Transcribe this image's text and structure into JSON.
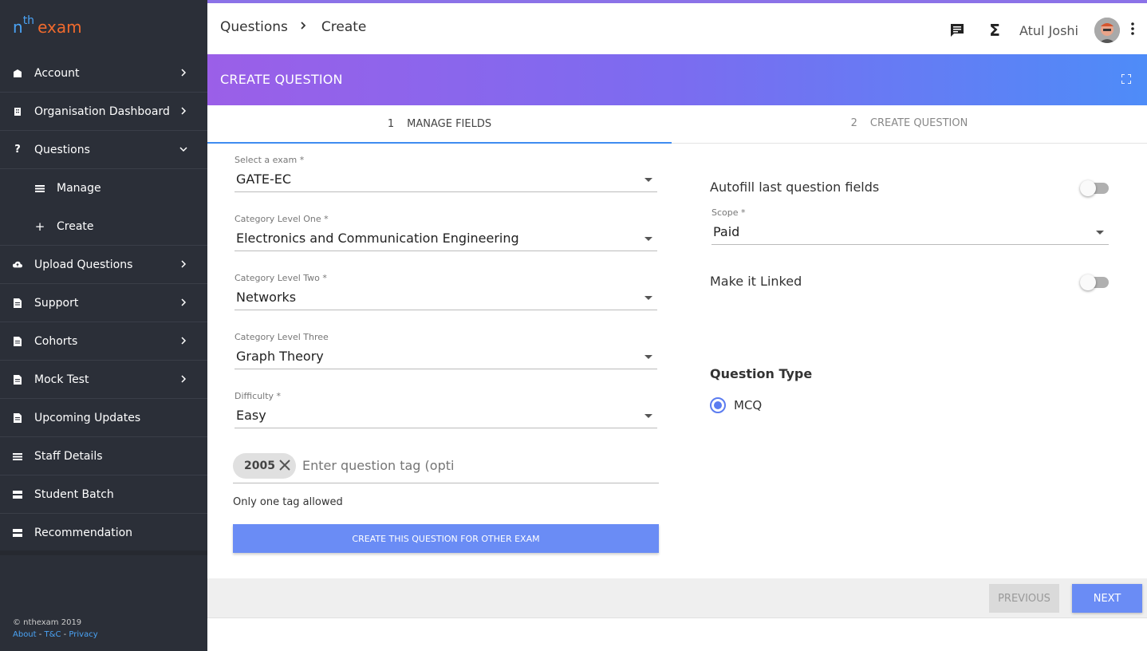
{
  "logo": {
    "n": "n",
    "th": "th",
    "exam": "exam"
  },
  "sidebar": {
    "items": [
      {
        "label": "Account",
        "icon": "account-icon",
        "chevron": "right"
      },
      {
        "label": "Organisation Dashboard",
        "icon": "building-icon",
        "chevron": "right"
      },
      {
        "label": "Questions",
        "icon": "question-icon",
        "chevron": "down"
      },
      {
        "label": "Manage",
        "icon": "list-icon"
      },
      {
        "label": "Create",
        "icon": "plus-icon"
      },
      {
        "label": "Upload Questions",
        "icon": "cloud-upload-icon",
        "chevron": "right"
      },
      {
        "label": "Support",
        "icon": "document-icon",
        "chevron": "right"
      },
      {
        "label": "Cohorts",
        "icon": "document-icon",
        "chevron": "right"
      },
      {
        "label": "Mock Test",
        "icon": "document-icon",
        "chevron": "right"
      },
      {
        "label": "Upcoming Updates",
        "icon": "document-icon"
      },
      {
        "label": "Staff Details",
        "icon": "list-icon"
      },
      {
        "label": "Student Batch",
        "icon": "storage-icon"
      },
      {
        "label": "Recommendation",
        "icon": "storage-icon"
      }
    ],
    "footer": {
      "copyright": "© nthexam 2019",
      "about": "About",
      "tc": "T&C",
      "privacy": "Privacy",
      "dash": " - "
    }
  },
  "header": {
    "breadcrumb": [
      "Questions",
      "Create"
    ],
    "sigma": "Σ",
    "user_name": "Atul Joshi"
  },
  "banner": {
    "title": "CREATE QUESTION"
  },
  "steps": [
    {
      "num": "1",
      "label": "MANAGE FIELDS",
      "active": true
    },
    {
      "num": "2",
      "label": "CREATE QUESTION",
      "active": false
    }
  ],
  "form": {
    "exam": {
      "label": "Select a exam *",
      "value": "GATE-EC"
    },
    "cat1": {
      "label": "Category Level One *",
      "value": "Electronics and Communication Engineering"
    },
    "cat2": {
      "label": "Category Level Two *",
      "value": "Networks"
    },
    "cat3": {
      "label": "Category Level Three",
      "value": "Graph Theory"
    },
    "difficulty": {
      "label": "Difficulty *",
      "value": "Easy"
    },
    "tag": {
      "chip": "2005",
      "placeholder": "Enter question tag (optional)"
    },
    "hint": "Only one tag allowed",
    "other_exam_button": "CREATE THIS QUESTION FOR OTHER EXAM"
  },
  "right": {
    "autofill_label": "Autofill last question fields",
    "autofill_on": false,
    "scope": {
      "label": "Scope *",
      "value": "Paid"
    },
    "linked_label": "Make it Linked",
    "linked_on": false,
    "question_type_label": "Question Type",
    "question_type_option": "MCQ"
  },
  "footer": {
    "previous": "PREVIOUS",
    "next": "NEXT"
  },
  "colors": {
    "accent": "#6a8cf5",
    "sidebar": "#2b2f38",
    "gradient_start": "#9b5fe8",
    "gradient_end": "#4e8cf8"
  }
}
